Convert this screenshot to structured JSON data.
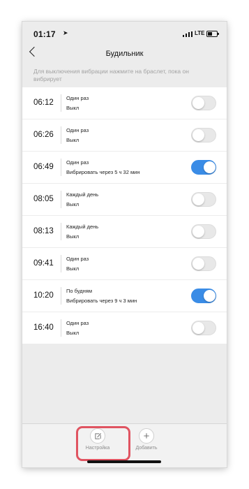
{
  "status_bar": {
    "time": "01:17",
    "location_icon": "location-arrow-icon",
    "network": "LTE",
    "signal_icon": "cellular-signal-icon",
    "battery_icon": "battery-icon"
  },
  "navbar": {
    "back_icon": "chevron-left-icon",
    "title": "Будильник"
  },
  "hint": "Для выключения вибрации нажмите на браслет, пока он вибрирует",
  "alarms": [
    {
      "time": "06:12",
      "label": "Один раз",
      "status": "Выкл",
      "enabled": false
    },
    {
      "time": "06:26",
      "label": "Один раз",
      "status": "Выкл",
      "enabled": false
    },
    {
      "time": "06:49",
      "label": "Один раз",
      "status": "Вибрировать через 5 ч 32 мин",
      "enabled": true
    },
    {
      "time": "08:05",
      "label": "Каждый день",
      "status": "Выкл",
      "enabled": false
    },
    {
      "time": "08:13",
      "label": "Каждый день",
      "status": "Выкл",
      "enabled": false
    },
    {
      "time": "09:41",
      "label": "Один раз",
      "status": "Выкл",
      "enabled": false
    },
    {
      "time": "10:20",
      "label": "По будням",
      "status": "Вибрировать через 9 ч 3 мин",
      "enabled": true
    },
    {
      "time": "16:40",
      "label": "Один раз",
      "status": "Выкл",
      "enabled": false
    }
  ],
  "tabbar": {
    "settings": {
      "label": "Настройка",
      "icon": "edit-icon",
      "highlighted": true
    },
    "add": {
      "label": "Добавить",
      "icon": "plus-icon",
      "glyph": "+"
    }
  },
  "colors": {
    "toggle_on": "#3a8ce6",
    "highlight": "#e05461",
    "background": "#ececec"
  }
}
